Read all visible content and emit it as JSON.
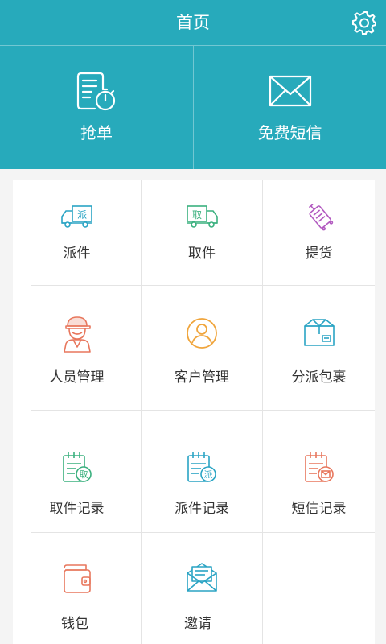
{
  "header": {
    "title": "首页",
    "settings_icon": "gear-icon",
    "accent_color": "#27aabb"
  },
  "hero": [
    {
      "label": "抢单",
      "icon": "order-timer-icon"
    },
    {
      "label": "免费短信",
      "icon": "envelope-icon"
    }
  ],
  "grid": [
    {
      "label": "派件",
      "icon": "delivery-truck-icon",
      "badge": "派"
    },
    {
      "label": "取件",
      "icon": "pickup-truck-icon",
      "badge": "取"
    },
    {
      "label": "提货",
      "icon": "luggage-icon"
    },
    {
      "label": "人员管理",
      "icon": "courier-person-icon"
    },
    {
      "label": "客户管理",
      "icon": "customer-icon"
    },
    {
      "label": "分派包裹",
      "icon": "package-icon"
    },
    {
      "label": "取件记录",
      "icon": "pickup-record-icon",
      "badge": "取"
    },
    {
      "label": "派件记录",
      "icon": "delivery-record-icon",
      "badge": "派"
    },
    {
      "label": "短信记录",
      "icon": "sms-record-icon"
    },
    {
      "label": "钱包",
      "icon": "wallet-icon"
    },
    {
      "label": "邀请",
      "icon": "invite-icon"
    }
  ]
}
